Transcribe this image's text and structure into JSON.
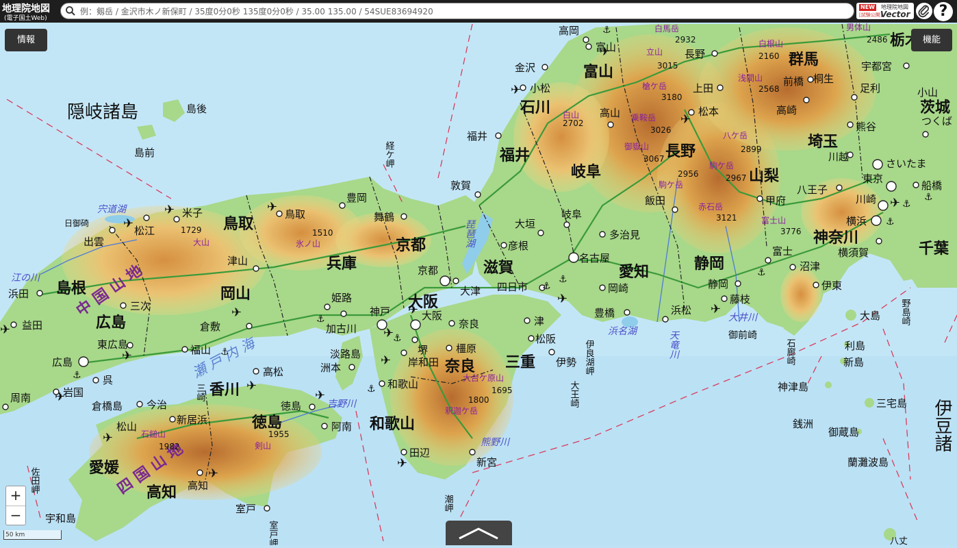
{
  "header": {
    "logo_title": "地理院地図",
    "logo_sub": "(電子国土Web)",
    "search_placeholder": "例：剱岳 / 金沢市木ノ新保町 / 35度0分0秒 135度0分0秒 / 35.00 135.00 / 54SUE83694920",
    "vector_new": "NEW",
    "vector_gsi": "地理院地図",
    "vector_trial": "[試験公開]",
    "vector_name": "Vector",
    "help": "?"
  },
  "buttons": {
    "info": "情報",
    "functions": "機能",
    "zoom_in": "+",
    "zoom_out": "−"
  },
  "scale_text": "50 km",
  "colors": {
    "sea": "#bfe3f5",
    "lowland": "#a8d88a",
    "hill": "#f2e08a",
    "mountain": "#e0a14a",
    "high": "#b8662a",
    "road": "#3a9a3a",
    "pref_border": "#222",
    "shipping": "#d93c5a",
    "lake_label": "#5a4fc8",
    "mtn_label": "#9a2fa0"
  },
  "labels": {
    "prefectures": [
      "島根",
      "鳥取",
      "岡山",
      "広島",
      "香川",
      "徳島",
      "愛媛",
      "高知",
      "兵庫",
      "京都",
      "大阪",
      "奈良",
      "和歌山",
      "滋賀",
      "三重",
      "福井",
      "石川",
      "富山",
      "岐阜",
      "愛知",
      "長野",
      "静岡",
      "山梨",
      "群馬",
      "埼玉",
      "東京",
      "神奈川",
      "千葉",
      "茨城",
      "栃木"
    ],
    "cities": [
      "米子",
      "松江",
      "出雲",
      "浜田",
      "益田",
      "三次",
      "東広島",
      "広島",
      "呉",
      "岩国",
      "周南",
      "松山",
      "今治",
      "新居浜",
      "高知",
      "宇和島",
      "室戸",
      "徳島",
      "阿南",
      "高松",
      "倉敷",
      "福山",
      "津山",
      "鳥取",
      "豊岡",
      "舞鶴",
      "姫路",
      "加古川",
      "神戸",
      "京都",
      "大阪",
      "堺",
      "岸和田",
      "和歌山",
      "田辺",
      "新宮",
      "奈良",
      "橿原",
      "津",
      "松阪",
      "伊勢",
      "四日市",
      "大津",
      "彦根",
      "大垣",
      "岐阜",
      "多治見",
      "名古屋",
      "岡崎",
      "豊橋",
      "浜松",
      "静岡",
      "藤枝",
      "富士",
      "沼津",
      "伊東",
      "甲府",
      "八王子",
      "東京",
      "川崎",
      "横浜",
      "横須賀",
      "さいたま",
      "川越",
      "船橋",
      "熊谷",
      "前橋",
      "高崎",
      "桐生",
      "足利",
      "宇都宮",
      "小山",
      "つくば",
      "上田",
      "松本",
      "飯田",
      "長野",
      "富山",
      "高岡",
      "金沢",
      "小松",
      "福井",
      "高山",
      "敦賀",
      "洲本",
      "浜松",
      "大島",
      "利島",
      "新島",
      "神津島",
      "三宅島",
      "御蔵島",
      "銭洲",
      "蘭灘波島",
      "八丈"
    ],
    "islands_and_seas": [
      "隠岐諸島",
      "島後",
      "島前",
      "経ケ岬",
      "日御碕",
      "江の川",
      "宍道湖",
      "吉野川",
      "熊野川",
      "大井川",
      "天竜川",
      "浜名湖",
      "琵琶湖",
      "淡路島",
      "倉橋島",
      "瀬戸内海",
      "伊良湖岬",
      "大王崎",
      "潮岬",
      "佐田岬",
      "室戸岬",
      "石廊崎",
      "御前崎",
      "野島崎",
      "伊豆諸島"
    ],
    "mountains": [
      {
        "name": "大山",
        "elev": "1729"
      },
      {
        "name": "氷ノ山",
        "elev": "1510"
      },
      {
        "name": "石鎚山",
        "elev": "1982"
      },
      {
        "name": "剣山",
        "elev": "1955"
      },
      {
        "name": "大台ケ原山",
        "elev": "1695"
      },
      {
        "name": "釈迦ケ岳",
        "elev": "1800"
      },
      {
        "name": "白馬岳",
        "elev": "2932"
      },
      {
        "name": "立山",
        "elev": "3015"
      },
      {
        "name": "槍ケ岳",
        "elev": "3180"
      },
      {
        "name": "乗鞍岳",
        "elev": "3026"
      },
      {
        "name": "御嶽山",
        "elev": "3067"
      },
      {
        "name": "白山",
        "elev": "2702"
      },
      {
        "name": "駒ケ岳",
        "elev": "2956"
      },
      {
        "name": "駒ケ岳",
        "elev": "2967"
      },
      {
        "name": "赤石岳",
        "elev": "3121"
      },
      {
        "name": "八ケ岳",
        "elev": "2899"
      },
      {
        "name": "富士山",
        "elev": "3776"
      },
      {
        "name": "白根山",
        "elev": "2160"
      },
      {
        "name": "浅間山",
        "elev": "2568"
      },
      {
        "name": "男体山",
        "elev": "2486"
      }
    ],
    "ranges": [
      "中国山地",
      "四国山地"
    ]
  }
}
